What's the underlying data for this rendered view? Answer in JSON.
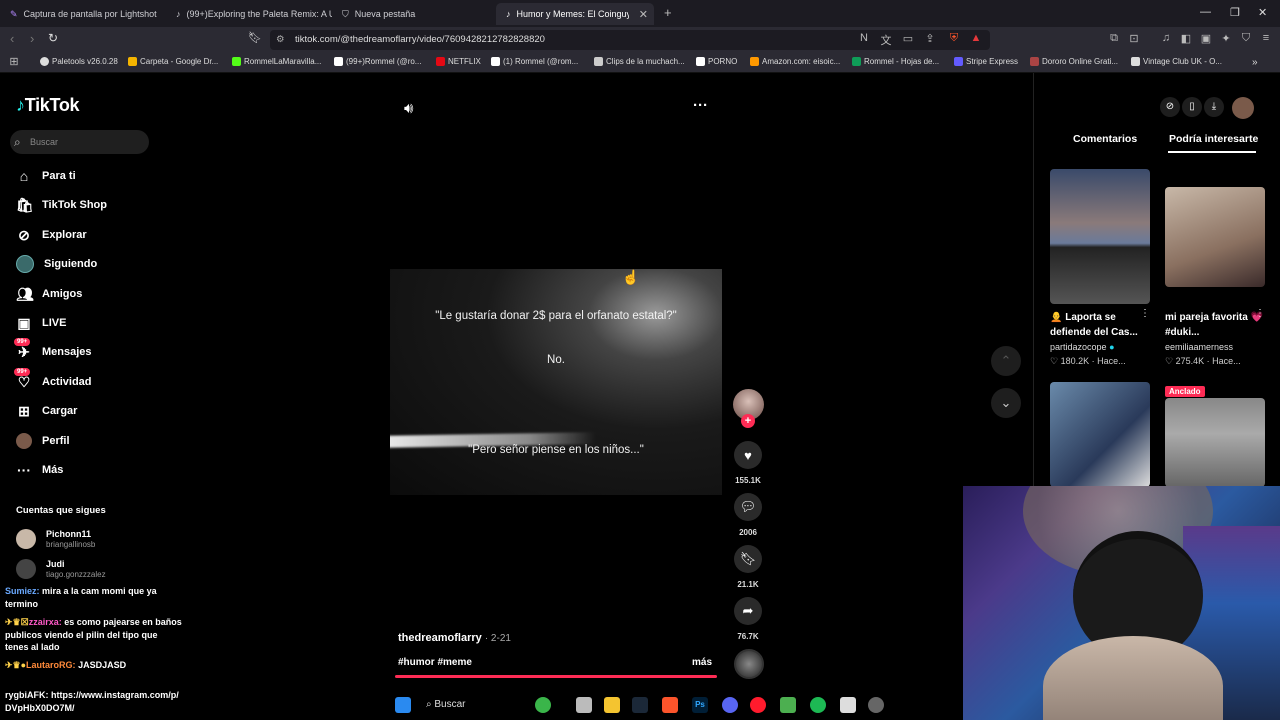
{
  "browser": {
    "tabs": [
      {
        "label": "Captura de pantalla por Lightshot"
      },
      {
        "label": "(99+)Exploring the Paleta Remix: A U"
      },
      {
        "label": "Nueva pestaña"
      },
      {
        "label": "Humor y Memes: El Coinguy y el"
      }
    ],
    "url": "tiktok.com/@thedreamoflarry/video/7609428212782828820",
    "bookmarks": [
      {
        "label": "Paletools v26.0.28",
        "color": "#e0e0e0"
      },
      {
        "label": "Carpeta - Google Dr...",
        "color": "#f4b400"
      },
      {
        "label": "RommelLaMaravilla...",
        "color": "#53fc18"
      },
      {
        "label": "(99+)Rommel (@ro...",
        "color": "#ffffff"
      },
      {
        "label": "NETFLIX",
        "color": "#e50914"
      },
      {
        "label": "(1) Rommel (@rom...",
        "color": "#ffffff"
      },
      {
        "label": "Clips de la muchach...",
        "color": "#cccccc"
      },
      {
        "label": "PORNO",
        "color": "#ffffff"
      },
      {
        "label": "Amazon.com: eisoic...",
        "color": "#ff9900"
      },
      {
        "label": "Rommel - Hojas de...",
        "color": "#0f9d58"
      },
      {
        "label": "Stripe Express",
        "color": "#635bff"
      },
      {
        "label": "Dororo Online Grati...",
        "color": "#aa4444"
      },
      {
        "label": "Vintage Club UK - O...",
        "color": "#dddddd"
      }
    ]
  },
  "tiktok": {
    "logo": "TikTok",
    "search_placeholder": "Buscar",
    "nav": [
      {
        "label": "Para ti",
        "icon": "home-icon"
      },
      {
        "label": "TikTok Shop",
        "icon": "shop-icon"
      },
      {
        "label": "Explorar",
        "icon": "compass-icon"
      },
      {
        "label": "Siguiendo",
        "icon": "following-icon"
      },
      {
        "label": "Amigos",
        "icon": "friends-icon"
      },
      {
        "label": "LIVE",
        "icon": "live-icon"
      },
      {
        "label": "Mensajes",
        "icon": "messages-icon",
        "badge": "99+"
      },
      {
        "label": "Actividad",
        "icon": "activity-icon",
        "badge": "99+"
      },
      {
        "label": "Cargar",
        "icon": "upload-icon"
      },
      {
        "label": "Perfil",
        "icon": "profile-icon"
      },
      {
        "label": "Más",
        "icon": "more-icon"
      }
    ],
    "following_title": "Cuentas que sigues",
    "following": [
      {
        "name": "Pichonn11",
        "handle": "briangallinosb"
      },
      {
        "name": "Judi",
        "handle": "tiago.gonzzzalez"
      }
    ],
    "video": {
      "line1": "\"Le gustaría donar 2$ para el orfanato estatal?\"",
      "line2": "No.",
      "line3": "\"Pero señor piense en los niños...\"",
      "author": "thedreamoflarry",
      "date": "· 2-21",
      "tags": "#humor #meme",
      "more": "más",
      "progress": 1.0
    },
    "actions": {
      "likes": "155.1K",
      "comments": "2006",
      "saves": "21.1K",
      "shares": "76.7K"
    },
    "right": {
      "tab_comments": "Comentarios",
      "tab_recommend": "Podría interesarte",
      "cards": [
        {
          "title": "🧑‍🦲 Laporta se defiende del Cas...",
          "user": "partidazocope",
          "stat": "♡ 180.2K · Hace..."
        },
        {
          "title": "mi pareja favorita 💗 #duki...",
          "user": "eemiliaamerness",
          "stat": "♡ 275.4K · Hace..."
        }
      ],
      "pinned": "Anclado"
    }
  },
  "chat": [
    {
      "user": "Sumiez:",
      "user_color": "#6aa9ff",
      "text": "mira a la cam momi que ya termino"
    },
    {
      "user": "zzairxa:",
      "user_color": "#ff5ac8",
      "text": "es como pajearse en baños publicos viendo el pilin del tipo que tenes al lado"
    },
    {
      "user": "LautaroRG:",
      "user_color": "#ff8a3a",
      "text": "JASDJASD"
    },
    {
      "user": "rygbiAFK:",
      "user_color": "#ffffff",
      "text": "https://www.instagram.com/p/DVpHbX0DO7M/"
    }
  ],
  "taskbar": {
    "search": "Buscar"
  }
}
